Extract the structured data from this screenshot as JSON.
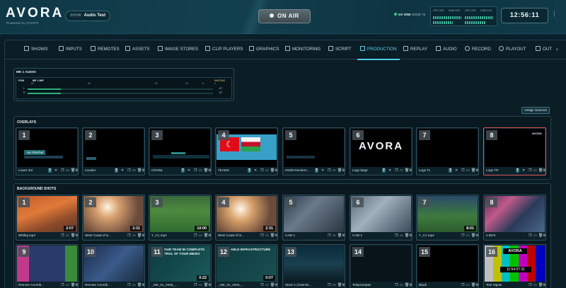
{
  "header": {
    "brand": "AVORA",
    "brand_tagline": "Powered by XAVIFP",
    "show_label": "SHOW",
    "show_name": "Audio Test",
    "on_air": "ON AIR",
    "gv_status": "GV ONE",
    "gv_sub": "NODE 78",
    "meters": [
      "CPU 32%",
      "RAM 34%",
      "GPU 23%",
      "DISK 51%"
    ],
    "clock": "12:56:11"
  },
  "tabs": [
    {
      "label": "SHOWS",
      "icon": "shows-icon"
    },
    {
      "label": "INPUTS",
      "icon": "inputs-icon"
    },
    {
      "label": "REMOTES",
      "icon": "remotes-icon"
    },
    {
      "label": "ASSETS",
      "icon": "assets-icon"
    },
    {
      "label": "IMAGE STORES",
      "icon": "image-stores-icon"
    },
    {
      "label": "CLIP PLAYERS",
      "icon": "clip-players-icon"
    },
    {
      "label": "GRAPHICS",
      "icon": "graphics-icon"
    },
    {
      "label": "MONITORING",
      "icon": "monitoring-icon"
    },
    {
      "label": "SCRIPT",
      "icon": "script-icon"
    },
    {
      "label": "PRODUCTION",
      "icon": "production-icon",
      "active": true
    },
    {
      "label": "REPLAY",
      "icon": "replay-icon"
    },
    {
      "label": "AUDIO",
      "icon": "audio-icon"
    },
    {
      "label": "RECORD",
      "icon": "record-icon"
    },
    {
      "label": "PLAYOUT",
      "icon": "playout-icon"
    },
    {
      "label": "OUT",
      "icon": "output-icon"
    }
  ],
  "audio": {
    "title": "ME 1 AUDIO",
    "pgm_label": "PGM",
    "me_label": "ME 1 M/E",
    "scale": [
      "-60",
      "-40",
      "-20",
      "-12",
      "-6",
      "0"
    ],
    "status": "WAITING",
    "levels": [
      "-67",
      "-67"
    ]
  },
  "assign_sources": "Assign Sources",
  "overlays": {
    "title": "OVERLAYS",
    "cards": [
      {
        "num": "1",
        "name": "Lower 3rd",
        "thumb_text": "Ian Fletcher"
      },
      {
        "num": "2",
        "name": "Locator",
        "thumb_text": ""
      },
      {
        "num": "3",
        "name": "CRAWL",
        "thumb_text": ""
      },
      {
        "num": "4",
        "name": "TEAMS",
        "thumb_text": ""
      },
      {
        "num": "5",
        "name": "Html5 Renders...",
        "thumb_text": ""
      },
      {
        "num": "6",
        "name": "Logo large",
        "thumb_text": "AVORA"
      },
      {
        "num": "7",
        "name": "Logo TL",
        "thumb_text": ""
      },
      {
        "num": "8",
        "name": "Logo TR",
        "thumb_text": "AVORA",
        "selected": true
      }
    ]
  },
  "backgrounds": {
    "title": "BACKGROUND SHOTS",
    "row1": [
      {
        "num": "1",
        "name": "Whitby.mp4",
        "duration": "2:07"
      },
      {
        "num": "2",
        "name": "West Coast of S...",
        "duration": "2:31"
      },
      {
        "num": "3",
        "name": "Y_C1.mp4",
        "duration": "10:00"
      },
      {
        "num": "4",
        "name": "West Coast of S...",
        "duration": "2:31"
      },
      {
        "num": "5",
        "name": "CAM 1",
        "duration": ""
      },
      {
        "num": "6",
        "name": "CAM 2",
        "duration": ""
      },
      {
        "num": "7",
        "name": "Y_C1.mp4",
        "duration": "8:01"
      },
      {
        "num": "8",
        "name": "2 BOX",
        "duration": ""
      }
    ],
    "row2": [
      {
        "num": "9",
        "name": "Remote Contrib...",
        "duration": ""
      },
      {
        "num": "10",
        "name": "Remote Contrib...",
        "duration": ""
      },
      {
        "num": "11",
        "name": "_ISE_01_2026_...",
        "duration": "0:22",
        "caption": "OUR TEAM IN COMPLETE TROL OF YOUR MEDIA"
      },
      {
        "num": "12",
        "name": "_ISE_01_2026_...",
        "duration": "0:07",
        "caption": "ABLE INFRASTRUCTURE"
      },
      {
        "num": "13",
        "name": "Store-1 (Artemis...",
        "duration": ""
      },
      {
        "num": "14",
        "name": "Teleprompter",
        "duration": ""
      },
      {
        "num": "15",
        "name": "Black",
        "duration": ""
      },
      {
        "num": "16",
        "name": "Test Signal",
        "duration": "",
        "caption": "AVORA",
        "clock": "11:54:07:31"
      }
    ]
  }
}
